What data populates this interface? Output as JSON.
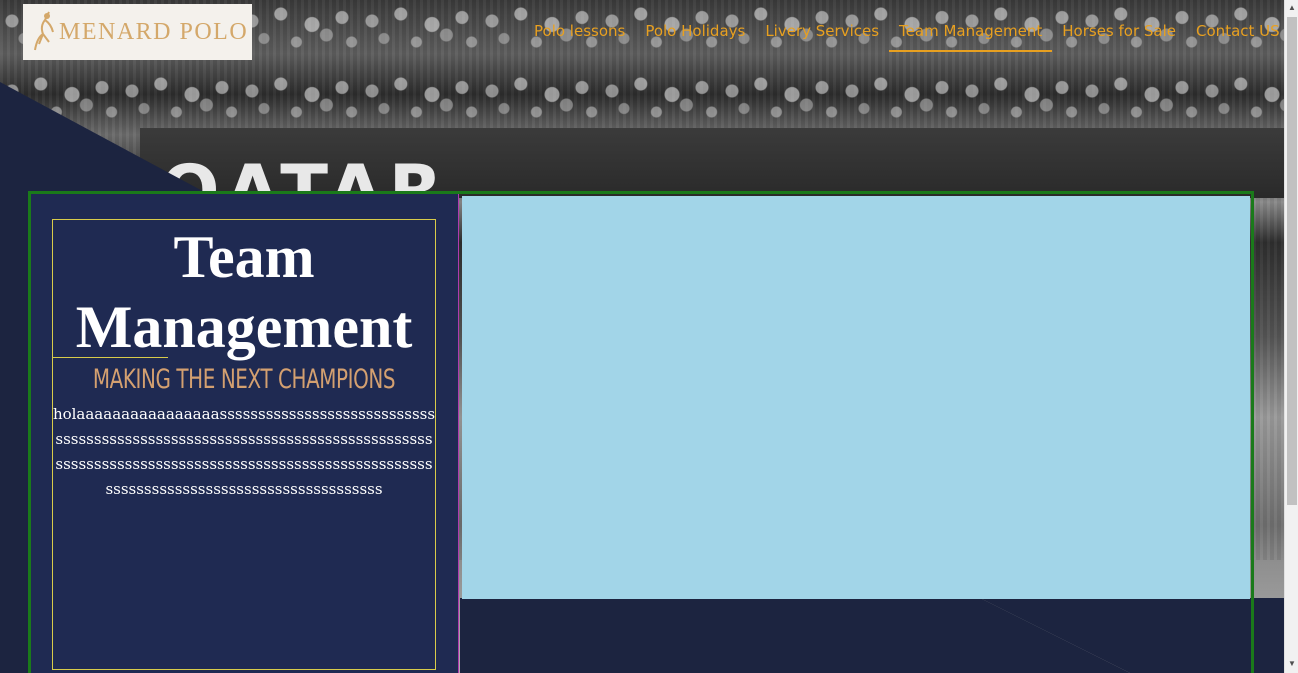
{
  "logo": {
    "text": "MENARD POLO"
  },
  "nav": {
    "items": [
      {
        "label": "Polo lessons"
      },
      {
        "label": "Polo Holidays"
      },
      {
        "label": "Livery Services"
      },
      {
        "label": "Team Management"
      },
      {
        "label": "Horses for Sale"
      },
      {
        "label": "Contact US"
      }
    ],
    "active_index": 3
  },
  "hero": {
    "banner_text": "QATAR"
  },
  "section": {
    "title": "Team Management",
    "subtitle": "MAKING THE NEXT CHAMPIONS",
    "body": "holaaaaaaaaaaaaaaaassssssssssssssssssssssssssssssssssssssssssssssssssssssssssssssssssssssssssssssssssssssssssssssssssssssssssssssssssssssssssssssssssssssssssssssssssssssssssssssssss"
  },
  "colors": {
    "accent": "#e8a020",
    "panel": "#1f2a52",
    "media_placeholder": "#a2d5e8",
    "frame": "#1a7a1a"
  }
}
